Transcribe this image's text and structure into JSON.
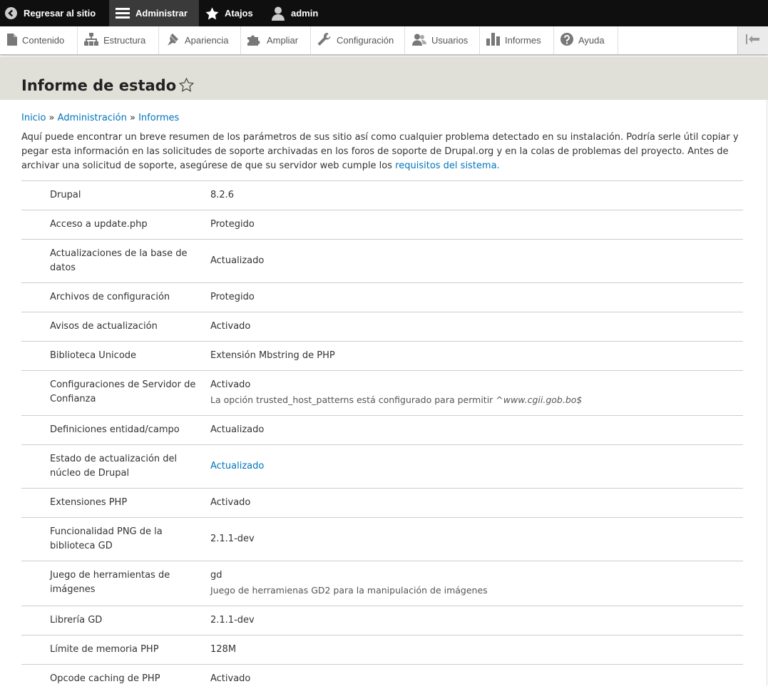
{
  "toolbar": {
    "back": "Regresar al sitio",
    "manage": "Administrar",
    "shortcuts": "Atajos",
    "user": "admin"
  },
  "tray": {
    "items": [
      {
        "label": "Contenido",
        "icon": "file-icon"
      },
      {
        "label": "Estructura",
        "icon": "sitemap-icon"
      },
      {
        "label": "Apariencia",
        "icon": "paintbrush-icon"
      },
      {
        "label": "Ampliar",
        "icon": "puzzle-icon"
      },
      {
        "label": "Configuración",
        "icon": "wrench-icon"
      },
      {
        "label": "Usuarios",
        "icon": "people-icon"
      },
      {
        "label": "Informes",
        "icon": "bar-chart-icon"
      },
      {
        "label": "Ayuda",
        "icon": "help-icon"
      }
    ]
  },
  "page": {
    "title": "Informe de estado"
  },
  "breadcrumb": {
    "home": "Inicio",
    "sep": "»",
    "admin": "Administración",
    "reports": "Informes"
  },
  "description": {
    "text": "Aquí puede encontrar un breve resumen de los parámetros de sus sitio así como cualquier problema detectado en su instalación. Podría serle útil copiar y pegar esta información en las solicitudes de soporte archivadas en los foros de soporte de Drupal.org y en la colas de problemas del proyecto. Antes de archivar una solicitud de soporte, asegúrese de que su servidor web cumple los",
    "link": "requisitos del sistema."
  },
  "rows": [
    {
      "name": "Drupal",
      "value": "8.2.6"
    },
    {
      "name": "Acceso a update.php",
      "value": "Protegido"
    },
    {
      "name": "Actualizaciones de la base de datos",
      "value": "Actualizado"
    },
    {
      "name": "Archivos de configuración",
      "value": "Protegido"
    },
    {
      "name": "Avisos de actualización",
      "value": "Activado"
    },
    {
      "name": "Biblioteca Unicode",
      "value": "Extensión Mbstring de PHP"
    },
    {
      "name": "Configuraciones de Servidor de Confianza",
      "value": "Activado",
      "desc": "La opción trusted_host_patterns está configurado para permitir",
      "desc_host": "^www.cgii.gob.bo$"
    },
    {
      "name": "Definiciones entidad/campo",
      "value": "Actualizado"
    },
    {
      "name": "Estado de actualización del núcleo de Drupal",
      "value": "Actualizado"
    },
    {
      "name": "Extensiones PHP",
      "value": "Activado"
    },
    {
      "name": "Funcionalidad PNG de la biblioteca GD",
      "value": "2.1.1-dev"
    },
    {
      "name": "Juego de herramientas de imágenes",
      "value": "gd",
      "desc": "Juego de herramienas GD2 para la manipulación de imágenes"
    },
    {
      "name": "Librería GD",
      "value": "2.1.1-dev"
    },
    {
      "name": "Límite de memoria PHP",
      "value": "128M"
    },
    {
      "name": "Opcode caching de PHP",
      "value": "Activado"
    }
  ]
}
